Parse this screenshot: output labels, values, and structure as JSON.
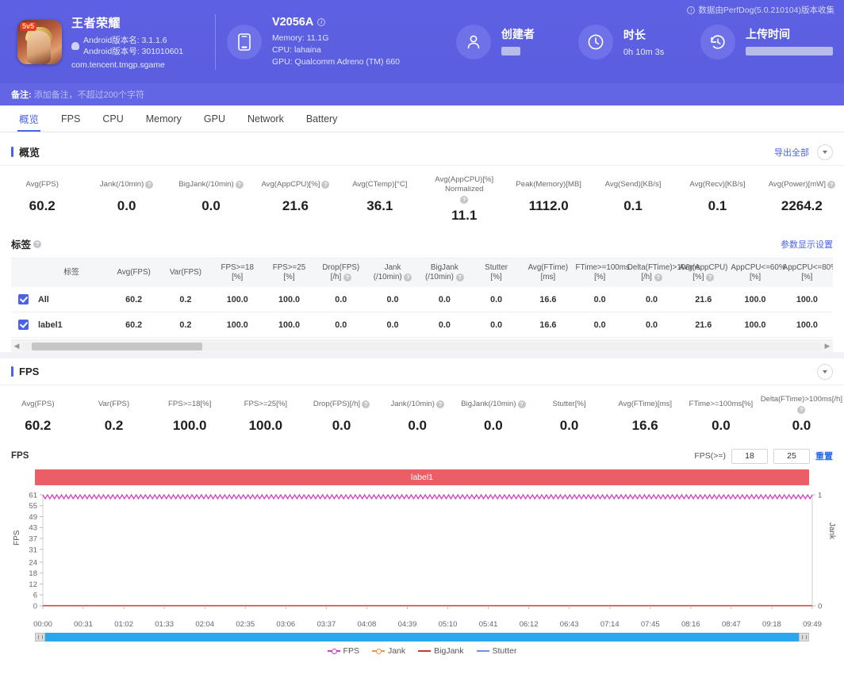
{
  "header": {
    "collect_note": "数据由PerfDog(5.0.210104)版本收集",
    "app": {
      "name": "王者荣耀",
      "version_name": "Android版本名: 3.1.1.6",
      "version_code": "Android版本号: 301010601",
      "package": "com.tencent.tmgp.sgame",
      "icon": "game-app-icon",
      "badge": "5v5"
    },
    "device": {
      "model": "V2056A",
      "memory": "Memory: 11.1G",
      "cpu": "CPU: lahaina",
      "gpu": "GPU: Qualcomm Adreno (TM) 660",
      "icon": "phone-icon"
    },
    "creator": {
      "title": "创建者",
      "value": "",
      "icon": "user-icon"
    },
    "duration": {
      "title": "时长",
      "value": "0h 10m 3s",
      "icon": "clock-icon"
    },
    "upload": {
      "title": "上传时间",
      "value": "",
      "icon": "history-icon"
    }
  },
  "remark": {
    "label": "备注:",
    "placeholder": "添加备注，不超过200个字符"
  },
  "tabs": [
    {
      "label": "概览",
      "active": true
    },
    {
      "label": "FPS",
      "active": false
    },
    {
      "label": "CPU",
      "active": false
    },
    {
      "label": "Memory",
      "active": false
    },
    {
      "label": "GPU",
      "active": false
    },
    {
      "label": "Network",
      "active": false
    },
    {
      "label": "Battery",
      "active": false
    }
  ],
  "overview": {
    "title": "概览",
    "export_label": "导出全部",
    "metrics": [
      {
        "label": "Avg(FPS)",
        "help": false,
        "value": "60.2"
      },
      {
        "label": "Jank(/10min)",
        "help": true,
        "value": "0.0"
      },
      {
        "label": "BigJank(/10min)",
        "help": true,
        "value": "0.0"
      },
      {
        "label": "Avg(AppCPU)[%]",
        "help": true,
        "value": "21.6"
      },
      {
        "label": "Avg(CTemp)[°C]",
        "help": false,
        "value": "36.1"
      },
      {
        "label": "Avg(AppCPU)[%] Normalized",
        "help": true,
        "value": "11.1"
      },
      {
        "label": "Peak(Memory)[MB]",
        "help": false,
        "value": "1112.0"
      },
      {
        "label": "Avg(Send)[KB/s]",
        "help": false,
        "value": "0.1"
      },
      {
        "label": "Avg(Recv)[KB/s]",
        "help": false,
        "value": "0.1"
      },
      {
        "label": "Avg(Power)[mW]",
        "help": true,
        "value": "2264.2"
      }
    ]
  },
  "tags": {
    "title": "标签",
    "settings_label": "参数显示设置",
    "columns": [
      {
        "label": "标签",
        "help": false
      },
      {
        "label": "Avg(FPS)",
        "help": false
      },
      {
        "label": "Var(FPS)",
        "help": false
      },
      {
        "label": "FPS>=18 [%]",
        "help": false
      },
      {
        "label": "FPS>=25 [%]",
        "help": false
      },
      {
        "label": "Drop(FPS) [/h]",
        "help": true
      },
      {
        "label": "Jank (/10min)",
        "help": true
      },
      {
        "label": "BigJank (/10min)",
        "help": true
      },
      {
        "label": "Stutter [%]",
        "help": false
      },
      {
        "label": "Avg(FTime) [ms]",
        "help": false
      },
      {
        "label": "FTime>=100ms [%]",
        "help": false
      },
      {
        "label": "Delta(FTime)>100ms [/h]",
        "help": true
      },
      {
        "label": "Avg(AppCPU) [%]",
        "help": true
      },
      {
        "label": "AppCPU<=60% [%]",
        "help": false
      },
      {
        "label": "AppCPU<=80% [%]",
        "help": false
      }
    ],
    "rows": [
      {
        "checked": true,
        "name": "All",
        "values": [
          "60.2",
          "0.2",
          "100.0",
          "100.0",
          "0.0",
          "0.0",
          "0.0",
          "0.0",
          "16.6",
          "0.0",
          "0.0",
          "21.6",
          "100.0",
          "100.0"
        ]
      },
      {
        "checked": true,
        "name": "label1",
        "values": [
          "60.2",
          "0.2",
          "100.0",
          "100.0",
          "0.0",
          "0.0",
          "0.0",
          "0.0",
          "16.6",
          "0.0",
          "0.0",
          "21.6",
          "100.0",
          "100.0"
        ]
      }
    ]
  },
  "fps_panel": {
    "title": "FPS",
    "metrics": [
      {
        "label": "Avg(FPS)",
        "help": false,
        "value": "60.2"
      },
      {
        "label": "Var(FPS)",
        "help": false,
        "value": "0.2"
      },
      {
        "label": "FPS>=18[%]",
        "help": false,
        "value": "100.0"
      },
      {
        "label": "FPS>=25[%]",
        "help": false,
        "value": "100.0"
      },
      {
        "label": "Drop(FPS)[/h]",
        "help": true,
        "value": "0.0"
      },
      {
        "label": "Jank(/10min)",
        "help": true,
        "value": "0.0"
      },
      {
        "label": "BigJank(/10min)",
        "help": true,
        "value": "0.0"
      },
      {
        "label": "Stutter[%]",
        "help": false,
        "value": "0.0"
      },
      {
        "label": "Avg(FTime)[ms]",
        "help": false,
        "value": "16.6"
      },
      {
        "label": "FTime>=100ms[%]",
        "help": false,
        "value": "0.0"
      },
      {
        "label": "Delta(FTime)>100ms[/h]",
        "help": true,
        "value": "0.0"
      }
    ],
    "chart_name": "FPS",
    "threshold_label": "FPS(>=)",
    "threshold_1": "18",
    "threshold_2": "25",
    "reset_label": "重置",
    "label_bar": "label1"
  },
  "chart_data": {
    "type": "line",
    "title": "FPS",
    "xlabel": "",
    "ylabel": "FPS",
    "y2label": "Jank",
    "ylim": [
      0,
      61
    ],
    "y2lim": [
      0,
      1
    ],
    "yticks": [
      0,
      6,
      12,
      18,
      24,
      31,
      37,
      43,
      49,
      55,
      61
    ],
    "y2ticks": [
      0,
      1
    ],
    "xticks": [
      "00:00",
      "00:31",
      "01:02",
      "01:33",
      "02:04",
      "02:35",
      "03:06",
      "03:37",
      "04:08",
      "04:39",
      "05:10",
      "05:41",
      "06:12",
      "06:43",
      "07:14",
      "07:45",
      "08:16",
      "08:47",
      "09:18",
      "09:49"
    ],
    "grid": false,
    "legend_position": "bottom",
    "series": [
      {
        "name": "FPS",
        "color": "#d63fc4",
        "axis": "left",
        "mean": 60.2,
        "min": 59,
        "max": 61
      },
      {
        "name": "Jank",
        "color": "#f2913d",
        "axis": "right",
        "mean": 0.0,
        "min": 0,
        "max": 0
      },
      {
        "name": "BigJank",
        "color": "#c0393b",
        "axis": "right",
        "mean": 0.0,
        "min": 0,
        "max": 0
      },
      {
        "name": "Stutter",
        "color": "#6f92d8",
        "axis": "right",
        "mean": 0.0,
        "min": 0,
        "max": 0
      }
    ]
  }
}
